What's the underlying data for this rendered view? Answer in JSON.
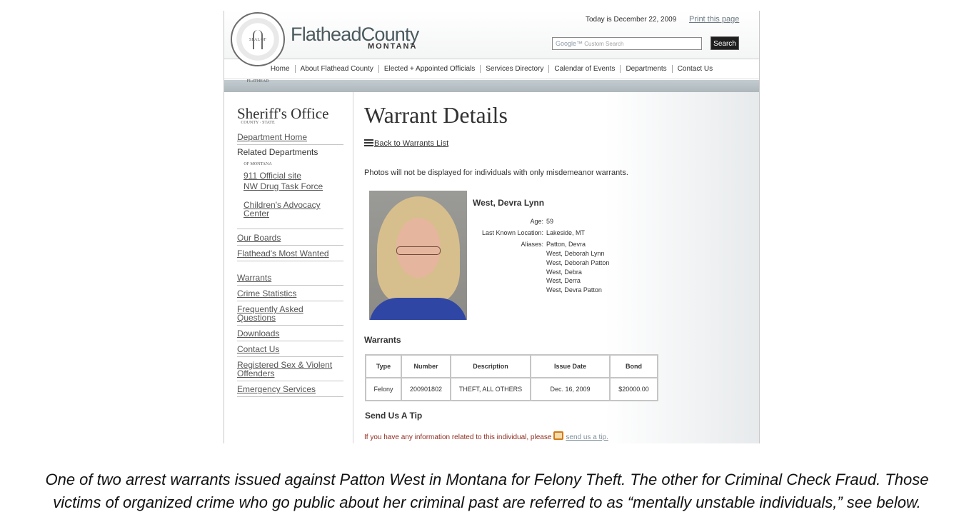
{
  "header": {
    "seal_text": "SEAL OF FLATHEAD COUNTY · STATE OF MONTANA",
    "brand_name": "FlatheadCounty",
    "brand_state": "MONTANA",
    "today": "Today is December 22, 2009",
    "print_link": "Print this page",
    "search_placeholder": "Custom Search",
    "search_google": "Google™",
    "search_button": "Search"
  },
  "nav": {
    "items": [
      "Home",
      "About Flathead  County",
      "Elected + Appointed Officials",
      "Services Directory",
      "Calendar of Events",
      "Departments",
      "Contact Us"
    ]
  },
  "sidebar": {
    "title": "Sheriff's Office",
    "department_home": "Department Home",
    "related_label": "Related Departments",
    "related": [
      "911 Official site",
      "NW Drug Task Force",
      "Children's Advocacy Center"
    ],
    "links": [
      "Our Boards",
      "Flathead's Most Wanted",
      "Warrants",
      "Crime Statistics",
      "Frequently Asked Questions",
      "Downloads",
      "Contact Us",
      "Registered Sex & Violent Offenders",
      "Emergency Services"
    ]
  },
  "main": {
    "heading": "Warrant Details",
    "back_link": "Back to Warrants List",
    "notice": "Photos will not be displayed for individuals with only misdemeanor warrants.",
    "person": {
      "name": "West, Devra Lynn",
      "age_label": "Age:",
      "age": "59",
      "location_label": "Last Known Location:",
      "location": "Lakeside, MT",
      "aliases_label": "Aliases:",
      "aliases": [
        "Patton, Devra",
        "West, Deborah Lynn",
        "West, Deborah Patton",
        "West, Debra",
        "West, Derra",
        "West, Devra Patton"
      ]
    },
    "warrants_title": "Warrants",
    "table": {
      "headers": [
        "Type",
        "Number",
        "Description",
        "Issue Date",
        "Bond"
      ],
      "rows": [
        [
          "Felony",
          "200901802",
          "THEFT, ALL OTHERS",
          "Dec. 16, 2009",
          "$20000.00"
        ]
      ]
    },
    "send_title": "Send Us A Tip",
    "tip_text": "If you have any information related to this individual, please",
    "tip_link": "send us a tip."
  },
  "caption": {
    "line1": "One of two arrest warrants issued against Patton West in Montana for Felony Theft.  The other for Criminal Check Fraud. Those",
    "line2": "victims of organized crime who go public about her criminal past are referred to as “mentally unstable individuals,” see below."
  }
}
